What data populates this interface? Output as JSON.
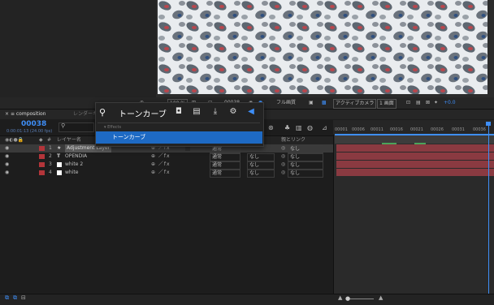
{
  "viewer": {
    "zoom": "100 %",
    "timecode": "00038",
    "quality": "フル画質",
    "camera": "アクティブカメラ",
    "views": "1 画面",
    "exposure": "+0.0"
  },
  "timeline": {
    "comp_tab": "composition",
    "render_tab": "レンダーキュー",
    "current_time": "00038",
    "time_sub": "0:00:01:13 (24.00 fps)",
    "columns": {
      "layer_name": "レイヤー名",
      "track_matte": "ット",
      "parent": "親とリンク"
    },
    "ruler_ticks": [
      "00001",
      "00006",
      "00011",
      "00016",
      "00021",
      "00026",
      "00031",
      "00036"
    ],
    "layers": [
      {
        "num": "1",
        "type": "★",
        "name": "Adjustment Layer",
        "mode": "通常",
        "matte": "",
        "parent": "なし"
      },
      {
        "num": "2",
        "type": "T",
        "name": "OPENDIA",
        "mode": "通常",
        "matte": "なし",
        "parent": "なし"
      },
      {
        "num": "3",
        "type": "■",
        "name": "white 2",
        "mode": "通常",
        "matte": "なし",
        "parent": "なし"
      },
      {
        "num": "4",
        "type": "■",
        "name": "white",
        "mode": "通常",
        "matte": "なし",
        "parent": "なし"
      }
    ]
  },
  "search": {
    "query": "トーンカーブ",
    "category": "Effects",
    "result": "トーンカーブ"
  },
  "colors": {
    "accent": "#3e8ef7",
    "label_red": "#b3353a",
    "selected": "#1e6ac4",
    "bar_red": "#8a3a41"
  }
}
